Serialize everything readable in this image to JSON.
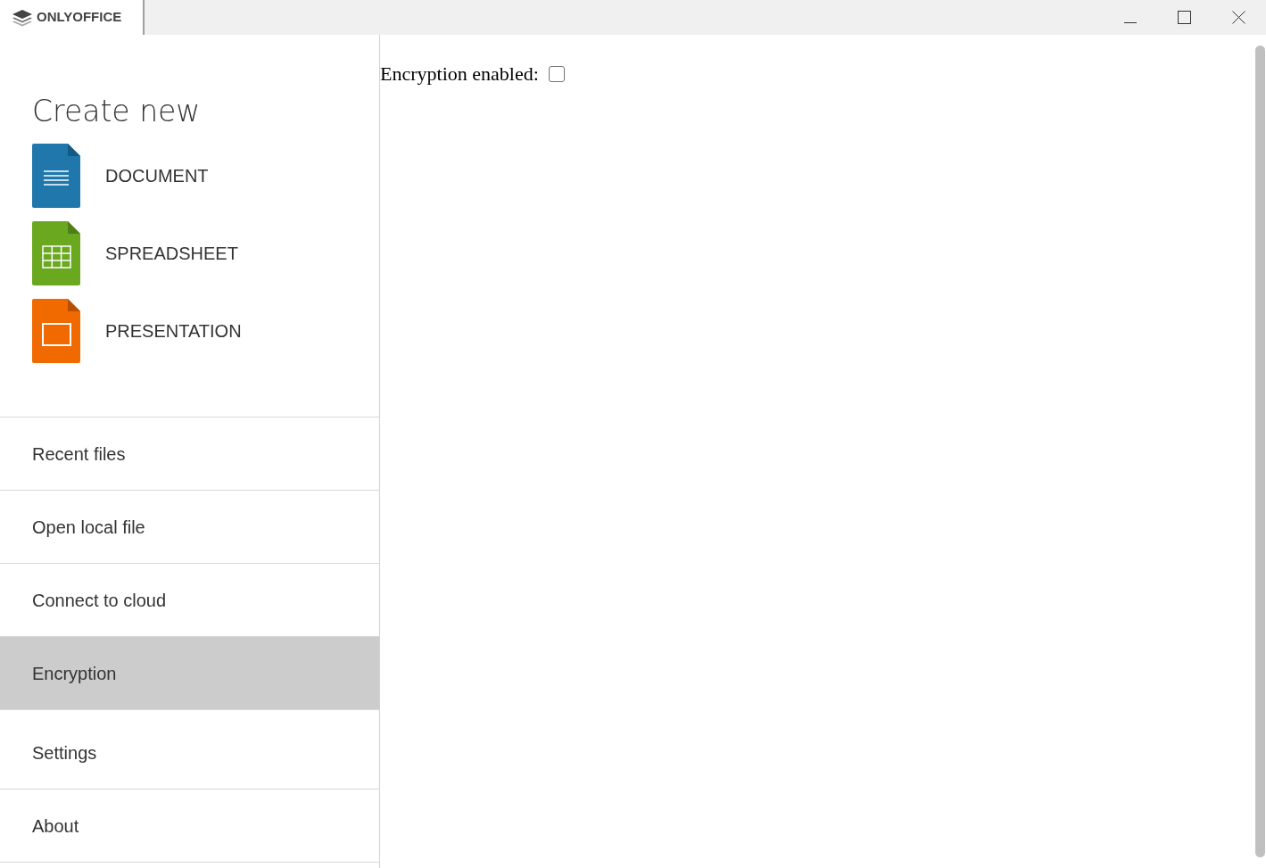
{
  "app": {
    "name": "ONLYOFFICE"
  },
  "sidebar": {
    "heading": "Create new",
    "create_items": [
      {
        "kind": "document",
        "label": "DOCUMENT"
      },
      {
        "kind": "spreadsheet",
        "label": "SPREADSHEET"
      },
      {
        "kind": "presentation",
        "label": "PRESENTATION"
      }
    ],
    "nav_items": [
      {
        "label": "Recent files",
        "selected": false
      },
      {
        "label": "Open local file",
        "selected": false
      },
      {
        "label": "Connect to cloud",
        "selected": false
      },
      {
        "label": "Encryption",
        "selected": true
      },
      {
        "label": "Settings",
        "selected": false
      },
      {
        "label": "About",
        "selected": false
      }
    ]
  },
  "content": {
    "encryption": {
      "label": "Encryption enabled:",
      "checked": false
    }
  }
}
